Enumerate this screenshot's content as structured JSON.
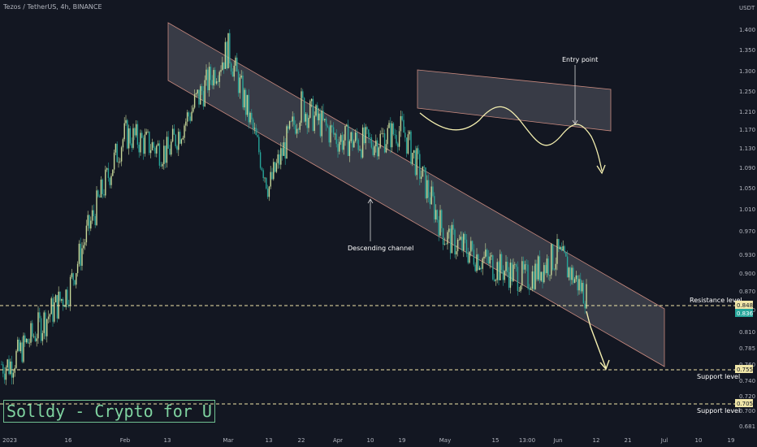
{
  "header": {
    "symbol_text": "Tezos / TetherUS, 4h, BINANCE"
  },
  "watermark": "Solldy - Crypto for U",
  "chart_data": {
    "type": "candlestick",
    "price_axis_unit": "USDT",
    "y_ticks": [
      "1.400",
      "1.350",
      "1.300",
      "1.250",
      "1.210",
      "1.170",
      "1.130",
      "1.090",
      "1.050",
      "1.010",
      "0.970",
      "0.930",
      "0.900",
      "0.870",
      "0.840",
      "0.810",
      "0.785",
      "0.760",
      "0.740",
      "0.720",
      "0.700",
      "0.681"
    ],
    "x_ticks": [
      "2023",
      "16",
      "Feb",
      "13",
      "Mar",
      "13",
      "22",
      "Apr",
      "10",
      "19",
      "May",
      "15",
      "13:00",
      "Jun",
      "12",
      "21",
      "Jul",
      "10",
      "19"
    ],
    "price_path": [
      [
        "2023",
        0.76
      ],
      [
        "16",
        0.87
      ],
      [
        "Feb",
        1.16
      ],
      [
        "13",
        1.12
      ],
      [
        "Mar",
        1.35
      ],
      [
        "13",
        1.05
      ],
      [
        "22",
        1.22
      ],
      [
        "Apr",
        1.15
      ],
      [
        "10",
        1.14
      ],
      [
        "19",
        1.17
      ],
      [
        "May",
        0.96
      ],
      [
        "15",
        0.91
      ],
      [
        "13:00",
        0.89
      ],
      [
        "Jun",
        0.93
      ],
      [
        "12",
        0.84
      ]
    ],
    "levels": [
      {
        "name": "Resistance level",
        "value": 0.848,
        "price_label": "0.848"
      },
      {
        "name": "Support level",
        "value": 0.755,
        "price_label": "0.755"
      },
      {
        "name": "Support level",
        "value": 0.705,
        "price_label": "0.705"
      }
    ],
    "current_price": {
      "value": 0.836,
      "label": "0.836"
    },
    "annotations": [
      "Descending channel",
      "Entry point"
    ],
    "colors": {
      "up": "#26a69a",
      "down": "#ef5350",
      "candle_up": "#c8d99a",
      "level": "#f0e6a8",
      "current": "#26a69a"
    }
  }
}
